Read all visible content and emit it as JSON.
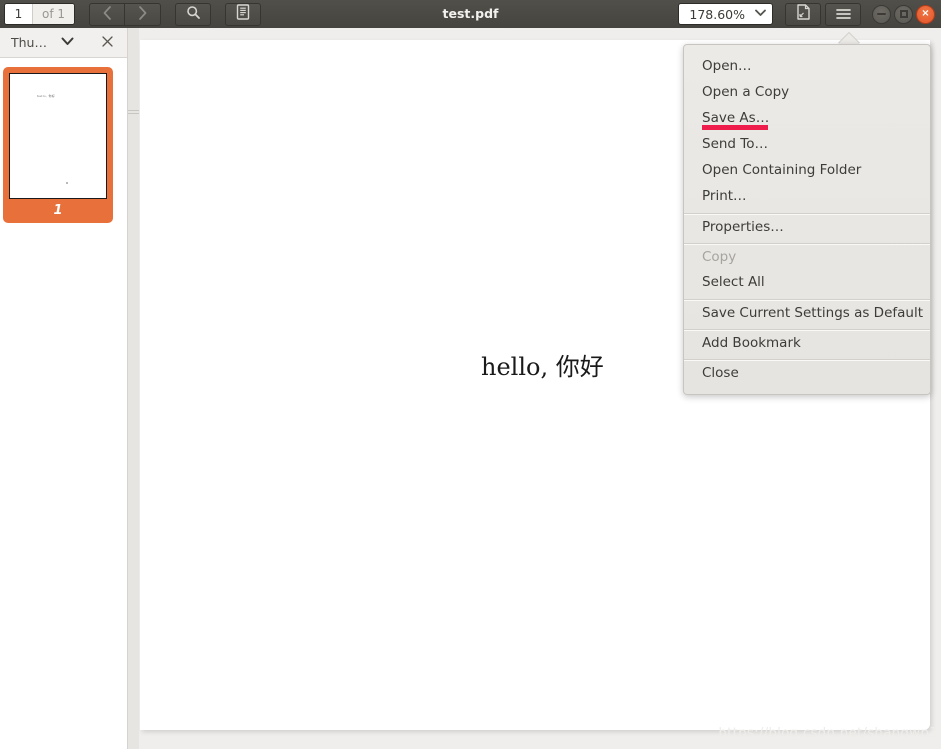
{
  "window": {
    "title": "test.pdf",
    "controls": {
      "minimize": "minimize-button",
      "maximize": "maximize-button",
      "close_glyph": "×"
    }
  },
  "toolbar": {
    "page_number": "1",
    "page_total_label": "of 1",
    "prev_page_glyph": "‹",
    "next_page_glyph": "›",
    "search_icon": "search-icon",
    "annotations_icon": "notes-icon",
    "zoom_value": "178.60%",
    "zoom_caret": "⌄",
    "view_mode_icon": "page-fit-icon",
    "menu_icon": "≡"
  },
  "sidebar": {
    "title": "Thu…",
    "caret": "⌄",
    "close_glyph": "×",
    "thumbnails": [
      {
        "label": "1",
        "preview_text": "hello, 你好",
        "selected": true
      }
    ]
  },
  "document": {
    "body_text": "hello, 你好",
    "watermark": "https://blog.csdn.net/shangwp3"
  },
  "menu": {
    "items": [
      {
        "label": "Open…",
        "disabled": false,
        "separator_above": false,
        "annotated": false
      },
      {
        "label": "Open a Copy",
        "disabled": false,
        "separator_above": false,
        "annotated": false
      },
      {
        "label": "Save As…",
        "disabled": false,
        "separator_above": false,
        "annotated": true
      },
      {
        "label": "Send To…",
        "disabled": false,
        "separator_above": false,
        "annotated": false
      },
      {
        "label": "Open Containing Folder",
        "disabled": false,
        "separator_above": false,
        "annotated": false
      },
      {
        "label": "Print…",
        "disabled": false,
        "separator_above": false,
        "annotated": false
      },
      {
        "label": "Properties…",
        "disabled": false,
        "separator_above": true,
        "annotated": false
      },
      {
        "label": "Copy",
        "disabled": true,
        "separator_above": true,
        "annotated": false
      },
      {
        "label": "Select All",
        "disabled": false,
        "separator_above": false,
        "annotated": false
      },
      {
        "label": "Save Current Settings as Default",
        "disabled": false,
        "separator_above": true,
        "annotated": false
      },
      {
        "label": "Add Bookmark",
        "disabled": false,
        "separator_above": true,
        "annotated": false
      },
      {
        "label": "Close",
        "disabled": false,
        "separator_above": true,
        "annotated": false
      }
    ]
  },
  "colors": {
    "titlebar": "#4a4842",
    "accent_orange": "#e8703a",
    "annotation_red": "#ee1d4c",
    "menu_bg": "#eceae7",
    "page_bg": "#ffffff",
    "viewport_bg": "#f0eeec"
  }
}
